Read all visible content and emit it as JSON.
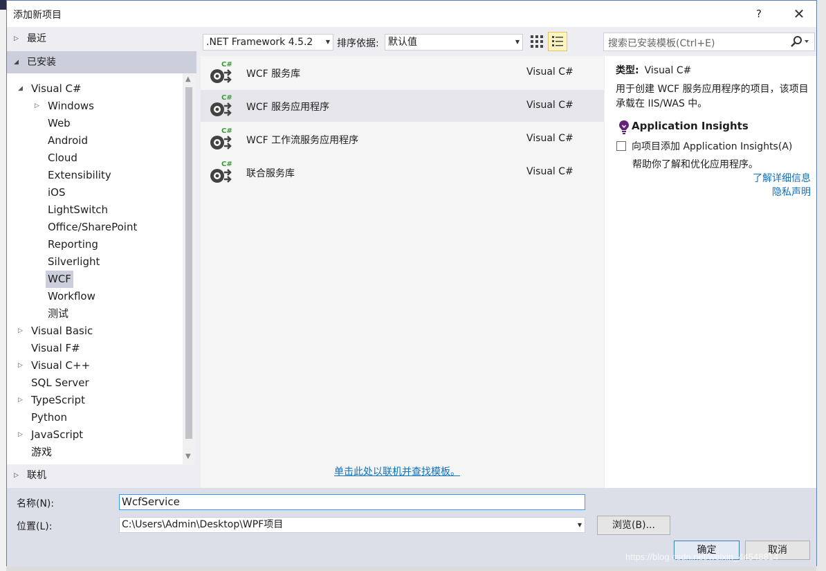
{
  "window": {
    "title": "添加新项目",
    "help": "?",
    "close": "✕"
  },
  "sidebar": {
    "recent": "最近",
    "installed": "已安装",
    "online": "联机",
    "tree": [
      {
        "label": "Visual C#",
        "level": 0,
        "expander": "expanded"
      },
      {
        "label": "Windows",
        "level": 1,
        "expander": "collapsed"
      },
      {
        "label": "Web",
        "level": 1,
        "expander": "none"
      },
      {
        "label": "Android",
        "level": 1,
        "expander": "none"
      },
      {
        "label": "Cloud",
        "level": 1,
        "expander": "none"
      },
      {
        "label": "Extensibility",
        "level": 1,
        "expander": "none"
      },
      {
        "label": "iOS",
        "level": 1,
        "expander": "none"
      },
      {
        "label": "LightSwitch",
        "level": 1,
        "expander": "none"
      },
      {
        "label": "Office/SharePoint",
        "level": 1,
        "expander": "none"
      },
      {
        "label": "Reporting",
        "level": 1,
        "expander": "none"
      },
      {
        "label": "Silverlight",
        "level": 1,
        "expander": "none"
      },
      {
        "label": "WCF",
        "level": 1,
        "expander": "none",
        "selected": true
      },
      {
        "label": "Workflow",
        "level": 1,
        "expander": "none"
      },
      {
        "label": "测试",
        "level": 1,
        "expander": "none"
      },
      {
        "label": "Visual Basic",
        "level": 0,
        "expander": "collapsed"
      },
      {
        "label": "Visual F#",
        "level": 0,
        "expander": "none"
      },
      {
        "label": "Visual C++",
        "level": 0,
        "expander": "collapsed"
      },
      {
        "label": "SQL Server",
        "level": 0,
        "expander": "none"
      },
      {
        "label": "TypeScript",
        "level": 0,
        "expander": "collapsed"
      },
      {
        "label": "Python",
        "level": 0,
        "expander": "none"
      },
      {
        "label": "JavaScript",
        "level": 0,
        "expander": "collapsed"
      },
      {
        "label": "游戏",
        "level": 0,
        "expander": "none"
      }
    ]
  },
  "toolbar": {
    "framework": ".NET Framework 4.5.2",
    "sort_label": "排序依据:",
    "sort_value": "默认值",
    "search_placeholder": "搜索已安装模板(Ctrl+E)"
  },
  "templates": [
    {
      "name": "WCF 服务库",
      "lang": "Visual C#",
      "badge": "C#"
    },
    {
      "name": "WCF 服务应用程序",
      "lang": "Visual C#",
      "badge": "C#",
      "selected": true
    },
    {
      "name": "WCF 工作流服务应用程序",
      "lang": "Visual C#",
      "badge": "C#"
    },
    {
      "name": "联合服务库",
      "lang": "Visual C#",
      "badge": "C#"
    }
  ],
  "online_link": "单击此处以联机并查找模板。",
  "details": {
    "type_label": "类型:",
    "type_value": "Visual C#",
    "description": "用于创建 WCF 服务应用程序的项目，该项目承载在 IIS/WAS 中。",
    "ai_title": "Application Insights",
    "ai_checkbox": "向项目添加 Application Insights(A)",
    "ai_help": "帮助你了解和优化应用程序。",
    "learn_more": "了解详细信息",
    "privacy": "隐私声明"
  },
  "form": {
    "name_label": "名称(N):",
    "name_value": "WcfService",
    "location_label": "位置(L):",
    "location_value": "C:\\Users\\Admin\\Desktop\\WPF项目",
    "browse": "浏览(B)...",
    "ok": "确定",
    "cancel": "取消"
  },
  "watermark": "https://blog.csdn.net/weixin_44548814",
  "colors": {
    "accent": "#0e70c0",
    "selection": "#cccedb",
    "badge_green": "#3a9a3a"
  }
}
